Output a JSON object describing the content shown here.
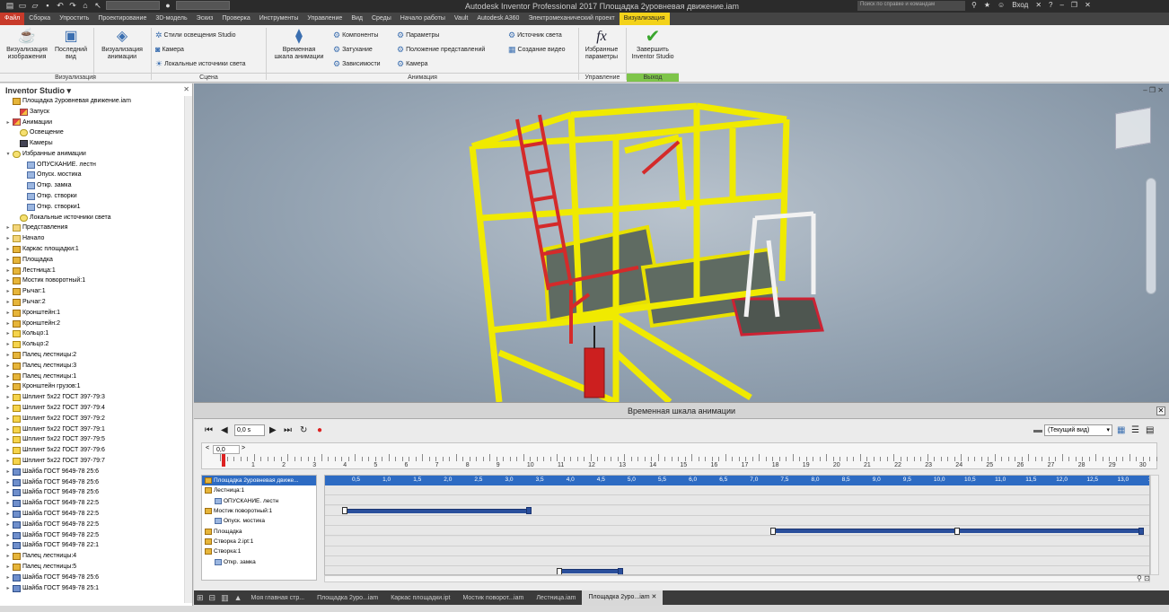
{
  "titlebar": {
    "title": "Autodesk Inventor Professional 2017    Площадка 2уровневая движение.iam",
    "search_placeholder": "Поиск по справке и командам",
    "signin": "Вход"
  },
  "tabs": [
    "Файл",
    "Сборка",
    "Упростить",
    "Проектирование",
    "3D-модель",
    "Эскиз",
    "Проверка",
    "Инструменты",
    "Управление",
    "Вид",
    "Среды",
    "Начало работы",
    "Vault",
    "Autodesk A360",
    "Электромеханический проект",
    "Визуализация"
  ],
  "ribbon": {
    "btn_render": "Визуализация\nизображения",
    "btn_last": "Последний\nвид",
    "btn_anim": "Визуализация\nанимации",
    "btn_timeline": "Временная\nшкала анимации",
    "btn_params": "Избранные\nпараметры",
    "btn_finish": "Завершить\nInventor Studio",
    "scene_items": [
      "Стили освещения Studio",
      "Камера",
      "Локальные источники света"
    ],
    "anim_col1": [
      "Компоненты",
      "Затухание",
      "Зависимости"
    ],
    "anim_col2": [
      "Параметры",
      "Положение представлений",
      "Камера"
    ],
    "anim_col3": [
      "Источник света",
      "Создание видео"
    ],
    "groups": {
      "render": "Визуализация",
      "scene": "Сцена",
      "animation": "Анимация",
      "manage": "Управление",
      "exit": "Выход"
    }
  },
  "browser": {
    "header": "Inventor Studio ▾",
    "items": [
      {
        "label": "Площадка 2уровневая движение.iam",
        "icon": "asm",
        "tw": "",
        "indent": 0
      },
      {
        "label": "Запуск",
        "icon": "anim",
        "tw": "",
        "indent": 1
      },
      {
        "label": "Анимации",
        "icon": "anim",
        "tw": "▸",
        "indent": 0
      },
      {
        "label": "Освещение",
        "icon": "light",
        "tw": "",
        "indent": 1
      },
      {
        "label": "Камеры",
        "icon": "cam",
        "tw": "",
        "indent": 1
      },
      {
        "label": "Избранные анимации",
        "icon": "light",
        "tw": "▾",
        "indent": 0
      },
      {
        "label": "ОПУСКАНИЕ. лестн",
        "icon": "path",
        "tw": "",
        "indent": 2
      },
      {
        "label": "Опуск. мостика",
        "icon": "path",
        "tw": "",
        "indent": 2
      },
      {
        "label": "Откр. замка",
        "icon": "path",
        "tw": "",
        "indent": 2
      },
      {
        "label": "Откр. створки",
        "icon": "path",
        "tw": "",
        "indent": 2
      },
      {
        "label": "Откр. створки1",
        "icon": "path",
        "tw": "",
        "indent": 2
      },
      {
        "label": "Локальные источники света",
        "icon": "light",
        "tw": "",
        "indent": 1
      },
      {
        "label": "Представления",
        "icon": "folder",
        "tw": "▸",
        "indent": 0
      },
      {
        "label": "Начало",
        "icon": "folder",
        "tw": "▸",
        "indent": 0
      },
      {
        "label": "Каркас площадки:1",
        "icon": "asm",
        "tw": "▸",
        "indent": 0
      },
      {
        "label": "Площадка",
        "icon": "asm",
        "tw": "▸",
        "indent": 0
      },
      {
        "label": "Лестница:1",
        "icon": "asm",
        "tw": "▸",
        "indent": 0
      },
      {
        "label": "Мостик поворотный:1",
        "icon": "asm",
        "tw": "▸",
        "indent": 0
      },
      {
        "label": "Рычаг:1",
        "icon": "asm",
        "tw": "▸",
        "indent": 0
      },
      {
        "label": "Рычаг:2",
        "icon": "asm",
        "tw": "▸",
        "indent": 0
      },
      {
        "label": "Кронштейн:1",
        "icon": "asm",
        "tw": "▸",
        "indent": 0
      },
      {
        "label": "Кронштейн:2",
        "icon": "asm",
        "tw": "▸",
        "indent": 0
      },
      {
        "label": "Кольцо:1",
        "icon": "part",
        "tw": "▸",
        "indent": 0
      },
      {
        "label": "Кольцо:2",
        "icon": "part",
        "tw": "▸",
        "indent": 0
      },
      {
        "label": "Палец лестницы:2",
        "icon": "asm",
        "tw": "▸",
        "indent": 0
      },
      {
        "label": "Палец лестницы:3",
        "icon": "asm",
        "tw": "▸",
        "indent": 0
      },
      {
        "label": "Палец лестницы:1",
        "icon": "asm",
        "tw": "▸",
        "indent": 0
      },
      {
        "label": "Кронштейн грузов:1",
        "icon": "asm",
        "tw": "▸",
        "indent": 0
      },
      {
        "label": "Шплинт 5х22 ГОСТ 397-79:3",
        "icon": "part",
        "tw": "▸",
        "indent": 0
      },
      {
        "label": "Шплинт 5х22 ГОСТ 397-79:4",
        "icon": "part",
        "tw": "▸",
        "indent": 0
      },
      {
        "label": "Шплинт 5х22 ГОСТ 397-79:2",
        "icon": "part",
        "tw": "▸",
        "indent": 0
      },
      {
        "label": "Шплинт 5х22 ГОСТ 397-79:1",
        "icon": "part",
        "tw": "▸",
        "indent": 0
      },
      {
        "label": "Шплинт 5х22 ГОСТ 397-79:5",
        "icon": "part",
        "tw": "▸",
        "indent": 0
      },
      {
        "label": "Шплинт 5х22 ГОСТ 397-79:6",
        "icon": "part",
        "tw": "▸",
        "indent": 0
      },
      {
        "label": "Шплинт 5х22 ГОСТ 397-79:7",
        "icon": "part",
        "tw": "▸",
        "indent": 0
      },
      {
        "label": "Шайба ГОСТ 9649-78 25:6",
        "icon": "washer",
        "tw": "▸",
        "indent": 0
      },
      {
        "label": "Шайба ГОСТ 9649-78 25:6",
        "icon": "washer",
        "tw": "▸",
        "indent": 0
      },
      {
        "label": "Шайба ГОСТ 9649-78 25:6",
        "icon": "washer",
        "tw": "▸",
        "indent": 0
      },
      {
        "label": "Шайба ГОСТ 9649-78 22:5",
        "icon": "washer",
        "tw": "▸",
        "indent": 0
      },
      {
        "label": "Шайба ГОСТ 9649-78 22:5",
        "icon": "washer",
        "tw": "▸",
        "indent": 0
      },
      {
        "label": "Шайба ГОСТ 9649-78 22:5",
        "icon": "washer",
        "tw": "▸",
        "indent": 0
      },
      {
        "label": "Шайба ГОСТ 9649-78 22:5",
        "icon": "washer",
        "tw": "▸",
        "indent": 0
      },
      {
        "label": "Шайба ГОСТ 9649-78 22:1",
        "icon": "washer",
        "tw": "▸",
        "indent": 0
      },
      {
        "label": "Палец лестницы:4",
        "icon": "asm",
        "tw": "▸",
        "indent": 0
      },
      {
        "label": "Палец лестницы:5",
        "icon": "asm",
        "tw": "▸",
        "indent": 0
      },
      {
        "label": "Шайба ГОСТ 9649-78 25:6",
        "icon": "washer",
        "tw": "▸",
        "indent": 0
      },
      {
        "label": "Шайба ГОСТ 9649-78 25:1",
        "icon": "washer",
        "tw": "▸",
        "indent": 0
      }
    ]
  },
  "timeline": {
    "title": "Временная шкала анимации",
    "time_value": "0,0 s",
    "cursor_value": "0,0",
    "view_select": "(Текущий вид)",
    "scale_ticks": [
      "1",
      "2",
      "3",
      "4",
      "5",
      "6",
      "7",
      "8",
      "9",
      "10",
      "11",
      "12",
      "13",
      "14",
      "15",
      "16",
      "17",
      "18",
      "19",
      "20",
      "21",
      "22",
      "23",
      "24",
      "25",
      "26",
      "27",
      "28",
      "29",
      "30"
    ],
    "header_ticks": [
      "0,5",
      "1,0",
      "1,5",
      "2,0",
      "2,5",
      "3,0",
      "3,5",
      "4,0",
      "4,5",
      "5,0",
      "5,5",
      "6,0",
      "6,5",
      "7,0",
      "7,5",
      "8,0",
      "8,5",
      "9,0",
      "9,5",
      "10,0",
      "10,5",
      "11,0",
      "11,5",
      "12,0",
      "12,5",
      "13,0",
      "13"
    ],
    "names": [
      {
        "label": "Площадка 2уровневая движе...",
        "sel": true,
        "icon": "asm"
      },
      {
        "label": "Лестница:1",
        "sel": false,
        "icon": "asm"
      },
      {
        "label": "ОПУСКАНИЕ. лестн",
        "sel": false,
        "icon": "path"
      },
      {
        "label": "Мостик поворотный:1",
        "sel": false,
        "icon": "asm"
      },
      {
        "label": "Опуск. мостика",
        "sel": false,
        "icon": "path"
      },
      {
        "label": "Площадка",
        "sel": false,
        "icon": "asm"
      },
      {
        "label": "Створка 2.ipt:1",
        "sel": false,
        "icon": "asm"
      },
      {
        "label": "Створка:1",
        "sel": false,
        "icon": "asm"
      },
      {
        "label": "Откр. замка",
        "sel": false,
        "icon": "path"
      }
    ],
    "actions": [
      {
        "row": 2,
        "start": 0.0,
        "end": 3.0
      },
      {
        "row": 4,
        "start": 7.0,
        "end": 10.0
      },
      {
        "row": 4,
        "start": 10.0,
        "end": 13.0
      },
      {
        "row": 8,
        "start": 3.5,
        "end": 4.5
      }
    ]
  },
  "doctabs": [
    "Моя главная стр...",
    "Площадка 2уро...iam",
    "Каркас площадки.ipt",
    "Мостик поворот...iam",
    "Лестница.iam",
    "Площадка 2уро...iam"
  ],
  "colors": {
    "accent": "#f3d21a",
    "file_tab": "#c83a2a",
    "selection": "#2d6bc3",
    "action_bar": "#2a4f9c"
  }
}
